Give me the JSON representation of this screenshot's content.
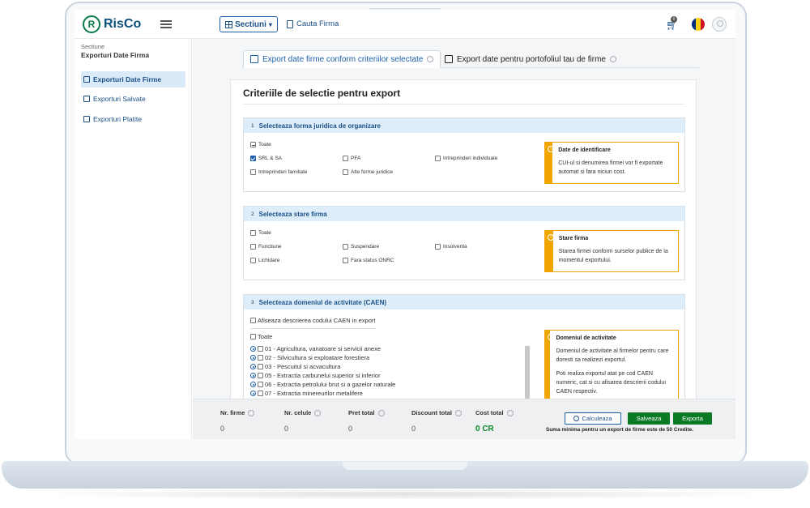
{
  "app": {
    "logo_letter": "R",
    "brand": "RisCo"
  },
  "topbar": {
    "sections_label": "Sectiuni",
    "search_company_label": "Cauta Firma",
    "cart_count": "0"
  },
  "sidebar": {
    "section_label": "Sectiune",
    "section_title": "Exporturi Date Firma",
    "items": [
      {
        "label": "Exporturi Date Firme",
        "active": true
      },
      {
        "label": "Exporturi Salvate",
        "active": false
      },
      {
        "label": "Exporturi Platite",
        "active": false
      }
    ]
  },
  "tabs": [
    {
      "label": "Export date firme conform criteriilor selectate",
      "active": true
    },
    {
      "label": "Export date pentru portofoliul tau de firme",
      "active": false
    }
  ],
  "panel": {
    "title": "Criteriile de selectie pentru export"
  },
  "sections": [
    {
      "num": "1",
      "title": "Selecteaza forma juridica de organizare",
      "all_label": "Toate",
      "options": [
        {
          "label": "SRL & SA",
          "checked": true
        },
        {
          "label": "PFA",
          "checked": false
        },
        {
          "label": "Intreprinderi individuale",
          "checked": false
        },
        {
          "label": "Intreprinderi familiale",
          "checked": false
        },
        {
          "label": "Alte forme juridice",
          "checked": false
        }
      ],
      "info": {
        "title": "Date de identificare",
        "text": "CUI-ul si denumirea firmei vor fi exportate automat si fara niciun cost."
      }
    },
    {
      "num": "2",
      "title": "Selecteaza stare firma",
      "all_label": "Toate",
      "options": [
        {
          "label": "Functiune",
          "checked": false
        },
        {
          "label": "Suspendare",
          "checked": false
        },
        {
          "label": "Insolventa",
          "checked": false
        },
        {
          "label": "Lichidare",
          "checked": false
        },
        {
          "label": "Fara status ONRC",
          "checked": false
        }
      ],
      "info": {
        "title": "Stare firma",
        "text": "Starea firmei conform surselor publice de la momentul exportului."
      }
    },
    {
      "num": "3",
      "title": "Selecteaza domeniul de activitate (CAEN)",
      "show_desc_label": "Afiseaza descrierea codului CAEN in export",
      "all_label": "Toate",
      "caen": [
        "01 - Agricultura, vanatoare si servicii anexe",
        "02 - Silvicultura si exploatare forestiera",
        "03 - Pescuitul si acvacultura",
        "05 - Extractia carbunelui superior si inferior",
        "06 - Extractia petrolului brut si a gazelor naturale",
        "07 - Extractia minereurilor metalifere"
      ],
      "info": {
        "title": "Domeniul de activitate",
        "text1": "Domeniul de activitate al firmelor pentru care doresti sa realizezi exportul.",
        "text2": "Poti realiza exportul atat pe cod CAEN numeric, cat si cu afisarea descrierii codului CAEN respectiv."
      }
    }
  ],
  "summary": {
    "stats": [
      {
        "label": "Nr. firme",
        "value": "0"
      },
      {
        "label": "Nr. celule",
        "value": "0"
      },
      {
        "label": "Pret total",
        "value": "0"
      },
      {
        "label": "Discount total",
        "value": "0"
      },
      {
        "label": "Cost total",
        "value": "0 CR"
      }
    ],
    "calc_label": "Calculeaza",
    "save_label": "Salveaza",
    "export_label": "Exporta",
    "note": "Suma minima pentru un export de firme este de 50 Credite."
  },
  "colors": {
    "brand_green": "#0b7a4b",
    "primary_blue": "#1b4f86",
    "warning": "#f0a500",
    "success": "#0a7a24"
  }
}
